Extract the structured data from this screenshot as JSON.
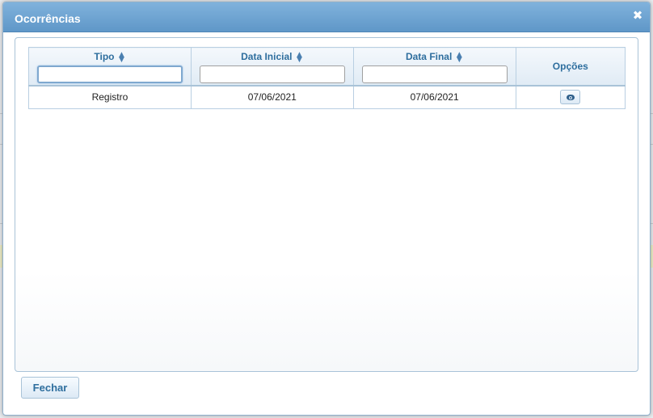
{
  "dialog": {
    "title": "Ocorrências",
    "close_icon": "close-icon"
  },
  "table": {
    "columns": [
      {
        "label": "Tipo",
        "sortable": true,
        "filter_value": ""
      },
      {
        "label": "Data Inicial",
        "sortable": true,
        "filter_value": ""
      },
      {
        "label": "Data Final",
        "sortable": true,
        "filter_value": ""
      },
      {
        "label": "Opções",
        "sortable": false
      }
    ],
    "rows": [
      {
        "tipo": "Registro",
        "data_inicial": "07/06/2021",
        "data_final": "07/06/2021",
        "action_icon": "eye-icon"
      }
    ]
  },
  "footer": {
    "close_label": "Fechar"
  },
  "colors": {
    "title_bar": "#6fa4d2",
    "header_text": "#2e6e9e",
    "border": "#a9c3d8"
  }
}
